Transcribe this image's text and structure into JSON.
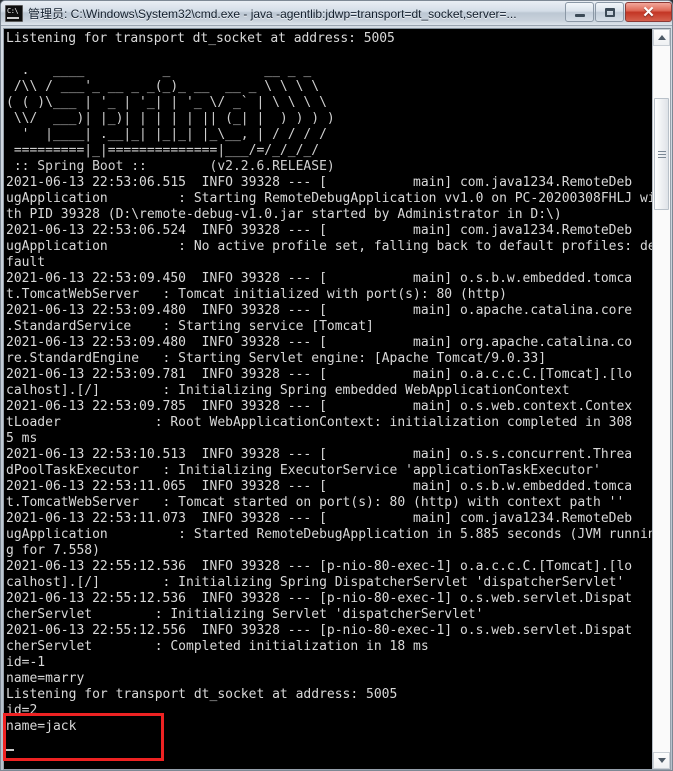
{
  "window": {
    "title": "管理员: C:\\Windows\\System32\\cmd.exe - java  -agentlib:jdwp=transport=dt_socket,server=...",
    "icon": "cmd-console-icon",
    "controls": {
      "minimize_label": "–",
      "maximize_label": "□",
      "close_label": "✕"
    }
  },
  "console": {
    "banner_title": ":: Spring Boot ::",
    "banner_version": "(v2.2.6.RELEASE)",
    "banner": "\n  .   ____          _            __ _ _\n /\\\\ / ___'_ __ _ _(_)_ __  __ _ \\ \\ \\ \\\n( ( )\\___ | '_ | '_| | '_ \\/ _` | \\ \\ \\ \\\n \\\\/  ___)| |_)| | | | | || (_| |  ) ) ) )\n  '  |____| .__|_| |_|_| |_\\__, | / / / /\n =========|_|==============|___/=/_/_/_/\n :: Spring Boot ::        (v2.2.6.RELEASE)\n",
    "listening_line_top": "Listening for transport dt_socket at address: 5005",
    "log": "2021-06-13 22:53:06.515  INFO 39328 --- [           main] com.java1234.RemoteDeb\nugApplication         : Starting RemoteDebugApplication vv1.0 on PC-20200308FHLJ wi\nth PID 39328 (D:\\remote-debug-v1.0.jar started by Administrator in D:\\)\n2021-06-13 22:53:06.524  INFO 39328 --- [           main] com.java1234.RemoteDeb\nugApplication         : No active profile set, falling back to default profiles: de\nfault\n2021-06-13 22:53:09.450  INFO 39328 --- [           main] o.s.b.w.embedded.tomca\nt.TomcatWebServer   : Tomcat initialized with port(s): 80 (http)\n2021-06-13 22:53:09.480  INFO 39328 --- [           main] o.apache.catalina.core\n.StandardService    : Starting service [Tomcat]\n2021-06-13 22:53:09.480  INFO 39328 --- [           main] org.apache.catalina.co\nre.StandardEngine   : Starting Servlet engine: [Apache Tomcat/9.0.33]\n2021-06-13 22:53:09.781  INFO 39328 --- [           main] o.a.c.c.C.[Tomcat].[lo\ncalhost].[/]        : Initializing Spring embedded WebApplicationContext\n2021-06-13 22:53:09.785  INFO 39328 --- [           main] o.s.web.context.Contex\ntLoader            : Root WebApplicationContext: initialization completed in 308\n5 ms\n2021-06-13 22:53:10.513  INFO 39328 --- [           main] o.s.s.concurrent.Threa\ndPoolTaskExecutor   : Initializing ExecutorService 'applicationTaskExecutor'\n2021-06-13 22:53:11.065  INFO 39328 --- [           main] o.s.b.w.embedded.tomca\nt.TomcatWebServer   : Tomcat started on port(s): 80 (http) with context path ''\n2021-06-13 22:53:11.073  INFO 39328 --- [           main] com.java1234.RemoteDeb\nugApplication         : Started RemoteDebugApplication in 5.885 seconds (JVM runnin\ng for 7.558)\n2021-06-13 22:55:12.536  INFO 39328 --- [p-nio-80-exec-1] o.a.c.c.C.[Tomcat].[lo\ncalhost].[/]        : Initializing Spring DispatcherServlet 'dispatcherServlet'\n2021-06-13 22:55:12.536  INFO 39328 --- [p-nio-80-exec-1] o.s.web.servlet.Dispat\ncherServlet        : Initializing Servlet 'dispatcherServlet'\n2021-06-13 22:55:12.556  INFO 39328 --- [p-nio-80-exec-1] o.s.web.servlet.Dispat\ncherServlet        : Completed initialization in 18 ms\nid=-1\nname=marry\nListening for transport dt_socket at address: 5005",
    "highlighted_output": "id=2\nname=jack",
    "highlight_color": "#ee2222"
  },
  "scrollbar": {
    "up_arrow": "scroll-up-arrow",
    "down_arrow": "scroll-down-arrow",
    "thumb": "scroll-thumb"
  }
}
